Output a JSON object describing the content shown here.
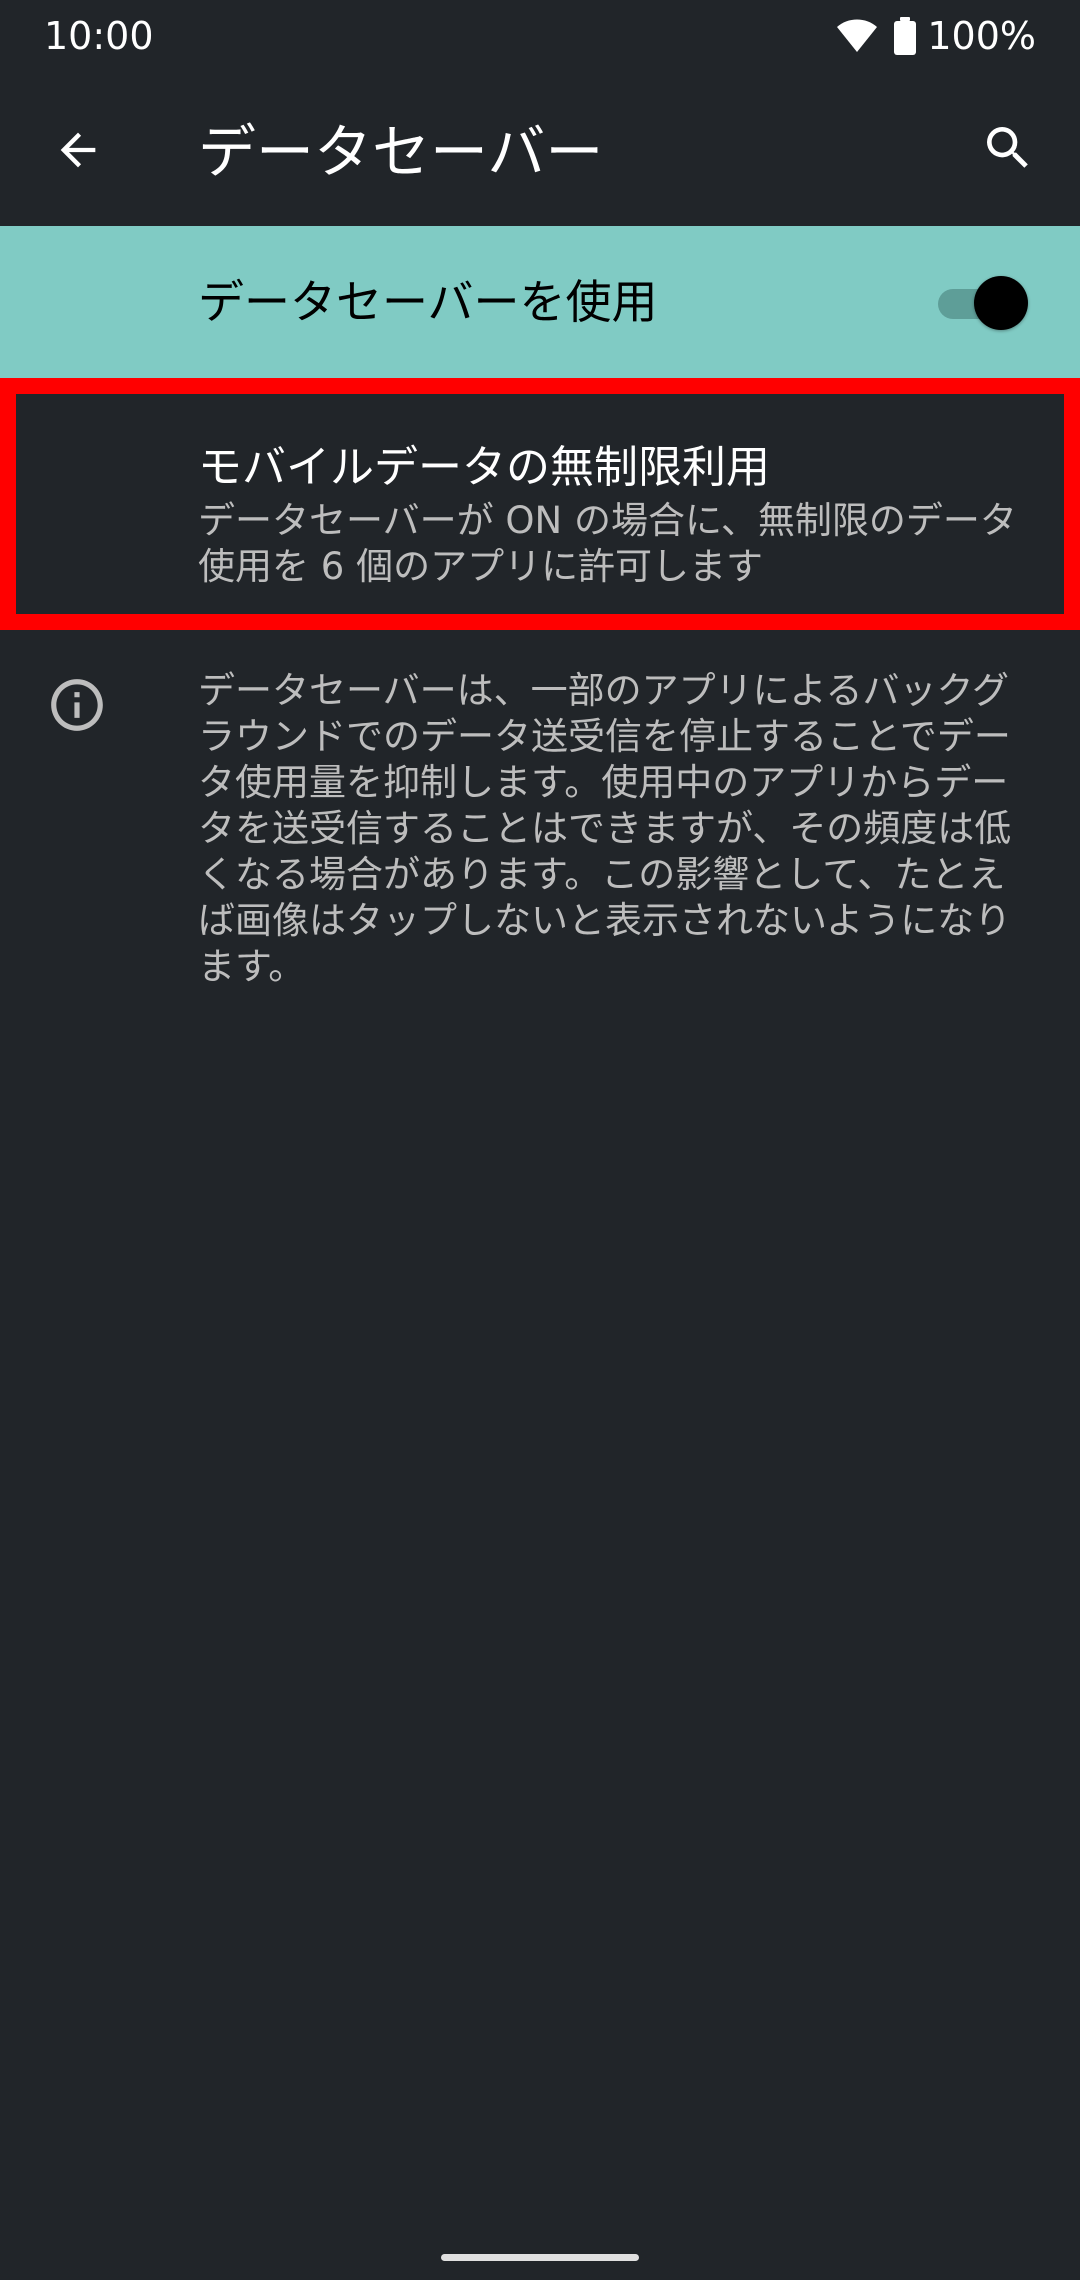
{
  "status_bar": {
    "time": "10:00",
    "battery_percent": "100%",
    "icons": [
      "wifi-icon",
      "battery-icon"
    ]
  },
  "app_bar": {
    "title": "データセーバー",
    "icons": [
      "back-arrow-icon",
      "search-icon"
    ]
  },
  "main_switch": {
    "label": "データセーバーを使用",
    "enabled": true,
    "background_color": "#80cbc4"
  },
  "unrestricted_data": {
    "title": "モバイルデータの無制限利用",
    "summary": "データセーバーが ON の場合に、無制限のデータ使用を 6 個のアプリに許可します",
    "highlight_color": "#ff0000"
  },
  "footer_info": {
    "icon": "info-icon",
    "text": "データセーバーは、一部のアプリによるバックグラウンドでのデータ送受信を停止することでデータ使用量を抑制します。使用中のアプリからデータを送受信することはできますが、その頻度は低くなる場合があります。この影響として、たとえば画像はタップしないと表示されないようになります。"
  },
  "theme": {
    "background": "#212529",
    "text_primary": "#ffffff",
    "text_secondary": "#bdbdbd"
  }
}
